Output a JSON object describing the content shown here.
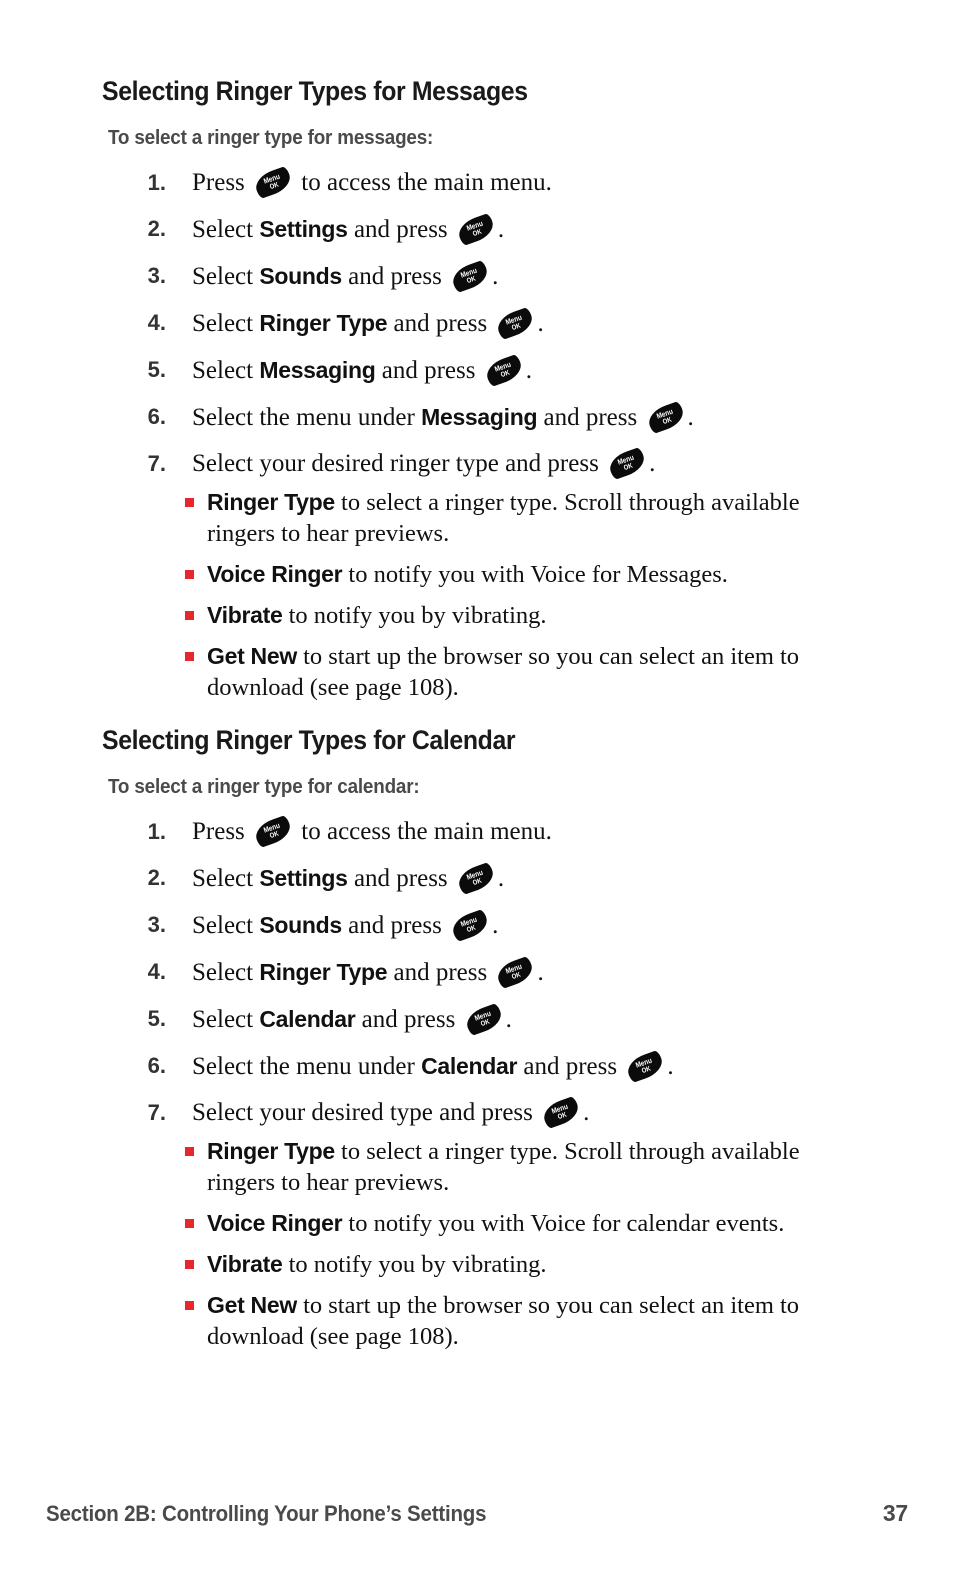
{
  "page": {
    "background": "#ffffff",
    "bullet_color": "#e8272c",
    "heading_color": "#1a1a1a",
    "intro_color": "#4a4a4a",
    "footer_color": "#4a4a4a"
  },
  "menu_key": {
    "line1": "Menu",
    "line2": "OK",
    "icon_name": "menu-ok-key-icon"
  },
  "sections": [
    {
      "heading": "Selecting Ringer Types for Messages",
      "intro": "To select a ringer type for messages:",
      "steps": [
        {
          "num": "1.",
          "pre": "Press ",
          "bold": "",
          "mid": "",
          "post": " to access the main menu.",
          "key_after": "pre"
        },
        {
          "num": "2.",
          "pre": "Select ",
          "bold": "Settings",
          "mid": " and press ",
          "post": ".",
          "key_after": "mid"
        },
        {
          "num": "3.",
          "pre": "Select ",
          "bold": "Sounds",
          "mid": " and press ",
          "post": ".",
          "key_after": "mid"
        },
        {
          "num": "4.",
          "pre": "Select ",
          "bold": "Ringer Type",
          "mid": " and press ",
          "post": ".",
          "key_after": "mid"
        },
        {
          "num": "5.",
          "pre": "Select ",
          "bold": "Messaging",
          "mid": " and press ",
          "post": ".",
          "key_after": "mid"
        },
        {
          "num": "6.",
          "pre": "Select the menu under ",
          "bold": "Messaging",
          "mid": " and press ",
          "post": ".",
          "key_after": "mid"
        },
        {
          "num": "7.",
          "pre": "Select your desired ringer type and press ",
          "bold": "",
          "mid": "",
          "post": ".",
          "key_after": "pre"
        }
      ],
      "bullets": [
        {
          "bold": "Ringer Type",
          "text": " to select a ringer type. Scroll through available ringers to hear previews."
        },
        {
          "bold": "Voice Ringer",
          "text": " to notify you with Voice for Messages."
        },
        {
          "bold": "Vibrate",
          "text": " to notify you by vibrating."
        },
        {
          "bold": "Get New",
          "text": " to start up the browser so you can select an item to download (see page 108)."
        }
      ]
    },
    {
      "heading": "Selecting Ringer Types for Calendar",
      "intro": "To select a ringer type for calendar:",
      "steps": [
        {
          "num": "1.",
          "pre": "Press ",
          "bold": "",
          "mid": "",
          "post": " to access the main menu.",
          "key_after": "pre"
        },
        {
          "num": "2.",
          "pre": "Select ",
          "bold": "Settings",
          "mid": " and press ",
          "post": ".",
          "key_after": "mid"
        },
        {
          "num": "3.",
          "pre": "Select ",
          "bold": "Sounds",
          "mid": " and press ",
          "post": ".",
          "key_after": "mid"
        },
        {
          "num": "4.",
          "pre": "Select ",
          "bold": "Ringer Type",
          "mid": " and press ",
          "post": ".",
          "key_after": "mid"
        },
        {
          "num": "5.",
          "pre": "Select ",
          "bold": "Calendar",
          "mid": " and press ",
          "post": ".",
          "key_after": "mid"
        },
        {
          "num": "6.",
          "pre": "Select the menu under ",
          "bold": "Calendar",
          "mid": " and press ",
          "post": ".",
          "key_after": "mid"
        },
        {
          "num": "7.",
          "pre": "Select your desired type and press ",
          "bold": "",
          "mid": "",
          "post": ".",
          "key_after": "pre"
        }
      ],
      "bullets": [
        {
          "bold": "Ringer Type",
          "text": " to select a ringer type. Scroll through available ringers to hear previews."
        },
        {
          "bold": "Voice Ringer",
          "text": " to notify you with Voice for calendar events."
        },
        {
          "bold": "Vibrate",
          "text": " to notify you by vibrating."
        },
        {
          "bold": "Get New",
          "text": " to start up the browser so you can select an item to download (see page 108)."
        }
      ]
    }
  ],
  "footer": {
    "left": "Section 2B: Controlling Your Phone’s Settings",
    "page_number": "37"
  }
}
